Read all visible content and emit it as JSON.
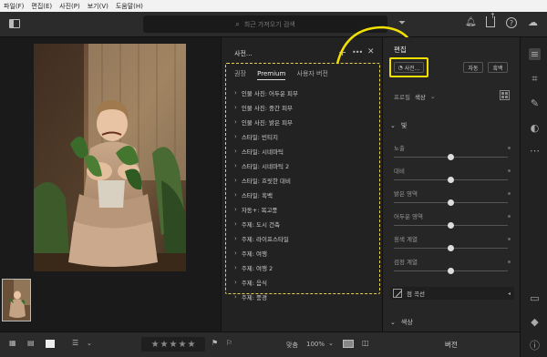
{
  "menubar": {
    "items": [
      "파일(F)",
      "편집(E)",
      "사진(P)",
      "보기(V)",
      "도움말(H)"
    ]
  },
  "search": {
    "placeholder": "최근 가져오기 검색"
  },
  "presets": {
    "title": "사전...",
    "tabs": [
      "권장",
      "Premium",
      "사용자 버전"
    ],
    "active_tab": 1,
    "items": [
      "인물 사진: 어두운 피부",
      "인물 사진: 중간 피부",
      "인물 사진: 밝은 피부",
      "스타일: 빈티지",
      "스타일: 시네마틱",
      "스타일: 시네마틱 2",
      "스타일: 흐릿한 대비",
      "스타일: 흑백",
      "자동+: 복고풍",
      "주제: 도시 건축",
      "주제: 라이프스타일",
      "주제: 여행",
      "주제: 여행 2",
      "주제: 음식",
      "주제: 풍경"
    ]
  },
  "edit": {
    "title": "편집",
    "presets_button": "사전...",
    "auto_button": "자동",
    "bw_button": "흑백",
    "profile_label": "프로필",
    "profile_value": "색상",
    "light_section": "빛",
    "sliders": [
      {
        "label": "노출",
        "value": 0.5
      },
      {
        "label": "대비",
        "value": 0.5
      },
      {
        "label": "밝은 영역",
        "value": 0.5
      },
      {
        "label": "어두운 영역",
        "value": 0.5
      },
      {
        "label": "흰색 계열",
        "value": 0.5
      },
      {
        "label": "검정 계열",
        "value": 0.5
      }
    ],
    "curve_label": "점 곡선",
    "color_section": "색상",
    "footer_label": "버전"
  },
  "bottombar": {
    "fit_label": "맞춤",
    "zoom": "100%"
  },
  "colors": {
    "highlight": "#f2e000",
    "panel": "#222222",
    "accent_dashed": "#e8d44a"
  }
}
